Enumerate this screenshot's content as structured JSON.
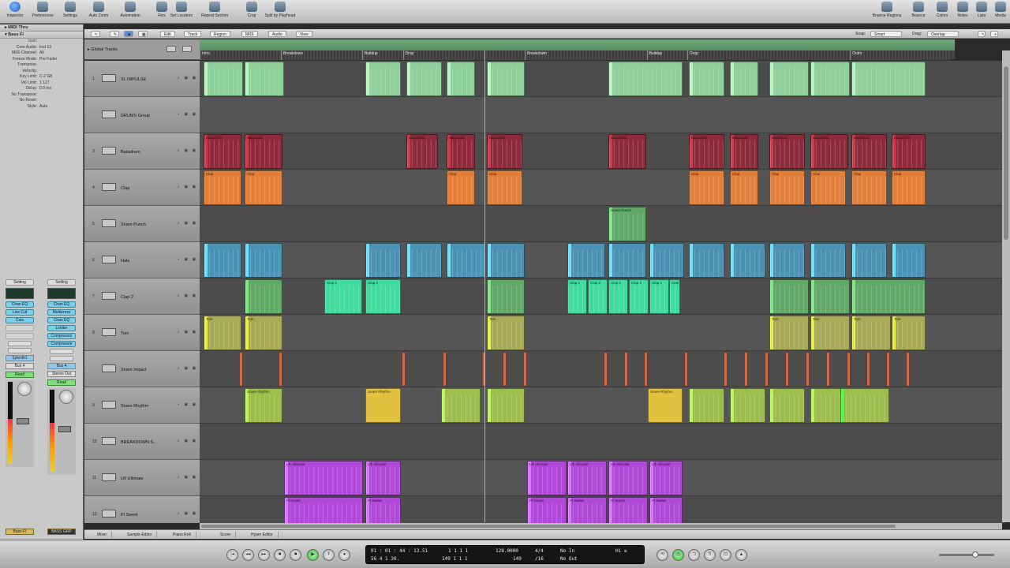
{
  "toolbar": {
    "left": [
      {
        "label": "Inspector",
        "icon": "info-icon"
      },
      {
        "label": "Preferences",
        "icon": "preferences-icon"
      },
      {
        "label": "Settings",
        "icon": "settings-icon"
      },
      {
        "label": "Auto Zoom",
        "icon": "auto-zoom-icon"
      },
      {
        "label": "Automation",
        "icon": "automation-icon"
      },
      {
        "label": "Flex",
        "icon": "flex-icon"
      },
      {
        "label": "Set Locators",
        "icon": "set-locators-icon"
      },
      {
        "label": "Repeat Section",
        "icon": "repeat-section-icon"
      },
      {
        "label": "Crop",
        "icon": "crop-icon"
      },
      {
        "label": "Split by Playhead",
        "icon": "split-icon"
      }
    ],
    "right": [
      {
        "label": "Bounce Regions",
        "icon": "bounce-regions-icon"
      },
      {
        "label": "Bounce",
        "icon": "bounce-icon"
      },
      {
        "label": "Colors",
        "icon": "colors-icon"
      },
      {
        "label": "Notes",
        "icon": "notes-icon"
      },
      {
        "label": "Lists",
        "icon": "lists-icon"
      },
      {
        "label": "Media",
        "icon": "media-icon"
      }
    ]
  },
  "inspector": {
    "header1": "▸ MIDI Thru",
    "header2": "▾ Bass Fl",
    "rows": [
      {
        "k": "Icon:",
        "v": ""
      },
      {
        "k": "Core Audio:",
        "v": "Inst 13"
      },
      {
        "k": "MIDI Channel:",
        "v": "All"
      },
      {
        "k": "Freeze Mode:",
        "v": "Pre Fader"
      },
      {
        "k": "Transpose:",
        "v": ""
      },
      {
        "k": "Velocity:",
        "v": ""
      },
      {
        "k": "Key Limit:",
        "v": "C-2  G8"
      },
      {
        "k": "Vel Limit:",
        "v": "1    127"
      },
      {
        "k": "Delay:",
        "v": "0.0 ms"
      },
      {
        "k": "No Transpose:",
        "v": ""
      },
      {
        "k": "No Reset:",
        "v": ""
      },
      {
        "k": "Style:",
        "v": "Auto"
      }
    ]
  },
  "strips": [
    {
      "setting": "Setting",
      "plugins": [
        "Chan EQ",
        "Low Cut",
        "Cuts",
        "",
        ""
      ],
      "io1": "Sylenth1",
      "io2": "Bus 4",
      "auto": "Read",
      "name": "Bass Fl",
      "meter": 0.55
    },
    {
      "setting": "Setting",
      "plugins": [
        "Chan EQ",
        "Multipress",
        "Chan EQ",
        "Limiter",
        "Compressor",
        "Compressor"
      ],
      "io1": "Bus 4",
      "io2": "Stereo Out",
      "auto": "Read",
      "name": "BASS GRP",
      "meter": 0.6
    }
  ],
  "arrange_menu": [
    "Edit",
    "Track",
    "Region",
    "MIDI",
    "Audio",
    "View"
  ],
  "snap_label": "Snap:",
  "snap_value": "Smart",
  "drag_label": "Drag:",
  "drag_value": "Overlap",
  "global_tracks": "▸ Global Tracks",
  "markers": [
    {
      "label": "Intro",
      "start": 1,
      "end": 21
    },
    {
      "label": "Breakdown",
      "start": 21,
      "end": 41
    },
    {
      "label": "Buildup",
      "start": 41,
      "end": 51
    },
    {
      "label": "Drop",
      "start": 51,
      "end": 81
    },
    {
      "label": "Breakdown",
      "start": 81,
      "end": 111
    },
    {
      "label": "Buildup",
      "start": 111,
      "end": 121
    },
    {
      "label": "Drop",
      "start": 121,
      "end": 161
    },
    {
      "label": "Outro",
      "start": 161,
      "end": 186
    }
  ],
  "tracks": [
    {
      "num": "1",
      "name": "SL IMPULSE"
    },
    {
      "num": "",
      "name": "DRUMS Group"
    },
    {
      "num": "3",
      "name": "Bassdrum"
    },
    {
      "num": "4",
      "name": "Clap"
    },
    {
      "num": "5",
      "name": "Snare Punch"
    },
    {
      "num": "6",
      "name": "Hats"
    },
    {
      "num": "7",
      "name": "Clap 2"
    },
    {
      "num": "8",
      "name": "Tom"
    },
    {
      "num": "",
      "name": "Snare Impact"
    },
    {
      "num": "9",
      "name": "Snare Rhythm"
    },
    {
      "num": "10",
      "name": "BREAKDOWN S..."
    },
    {
      "num": "11",
      "name": "LR Ultimate"
    },
    {
      "num": "12",
      "name": "Pl Sweet"
    }
  ],
  "region_colors": {
    "lead": "#8fcf9a",
    "kick": "#8e2a3a",
    "clap": "#e2803a",
    "snare": "#5fa865",
    "hats": "#4a93b4",
    "clap2": "#3fdca0",
    "tom": "#a8aa55",
    "impact": "#d4664a",
    "rhythm": "#9cbc4c",
    "yellow": "#e2c040",
    "purple": "#b048d8"
  },
  "region_labels": {
    "kick": "Bassdrum",
    "clap": "Clap",
    "snare_punch": "Snare Punch",
    "clap2": "Clap 2",
    "tom": "Tom",
    "rhythm": "Snare Rhythm",
    "lr": "LR Ultimate",
    "pl": "Pl Sweet"
  },
  "bottom_tabs": [
    "Mixer",
    "Sample Editor",
    "Piano Roll",
    "Score",
    "Hyper Editor"
  ],
  "transport": {
    "position_smpte": "01 : 01 : 44 : 13.51",
    "position_bars": "56   4   1   30.",
    "pos2_top": "1   1   1   1",
    "pos2_bottom": "149   1   1   1",
    "tempo": "128.0000",
    "bars_right": "149",
    "signature": "4/4",
    "division": "/16",
    "in_label": "No In",
    "out_label": "No Out",
    "cpu": "Hi ≡"
  },
  "region_texts": [
    "Clap 1",
    "Clap 2",
    "Clap 1",
    "Clap 2",
    "Clap 1",
    "Clap 2",
    "Clap 1",
    "Clap 2",
    "Clap 1",
    "Clap 2"
  ]
}
